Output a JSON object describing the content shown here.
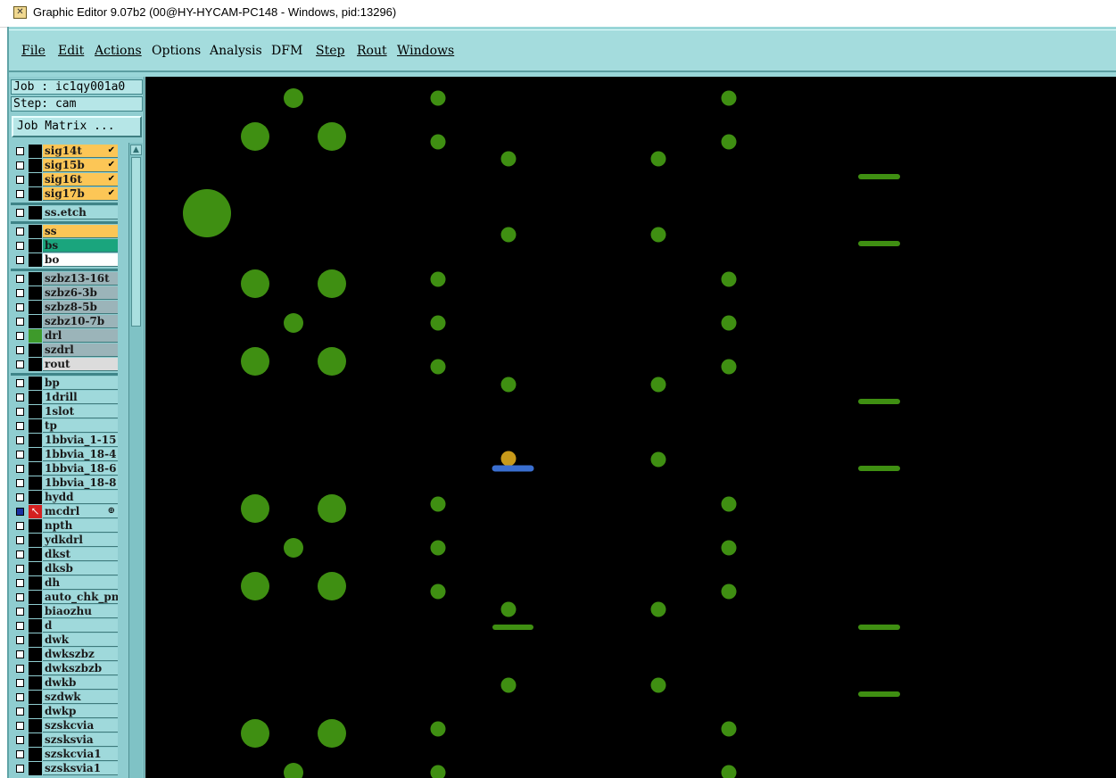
{
  "window": {
    "title": "Graphic Editor 9.07b2 (00@HY-HYCAM-PC148 - Windows, pid:13296)",
    "app_icon": "editor-app-icon"
  },
  "menu": [
    {
      "label": "File"
    },
    {
      "label": "Edit"
    },
    {
      "label": "Actions"
    },
    {
      "label": "Options"
    },
    {
      "label": "Analysis"
    },
    {
      "label": "DFM"
    },
    {
      "label": "Step"
    },
    {
      "label": "Rout"
    },
    {
      "label": "Windows"
    }
  ],
  "job_info": {
    "job": "Job : ic1qy001a0",
    "step": "Step: cam",
    "job_matrix_button": "Job Matrix ..."
  },
  "layers": [
    {
      "name": "sig14t",
      "color": "#fcc656",
      "mark": "✔"
    },
    {
      "name": "sig15b",
      "color": "#fcc656",
      "mark": "✔"
    },
    {
      "name": "sig16t",
      "color": "#fcc656",
      "mark": "✔"
    },
    {
      "name": "sig17b",
      "color": "#fcc656",
      "mark": "✔"
    },
    {
      "name": "ss.etch",
      "color": "#9fd9db",
      "mark": ""
    },
    {
      "name": "ss",
      "color": "#fcc656",
      "mark": ""
    },
    {
      "name": "bs",
      "color": "#1aa57d",
      "mark": ""
    },
    {
      "name": "bo",
      "color": "#ffffff",
      "mark": ""
    },
    {
      "name": "szbz13-16t",
      "color": "#9bb4b9",
      "mark": ""
    },
    {
      "name": "szbz6-3b",
      "color": "#9bb4b9",
      "mark": ""
    },
    {
      "name": "szbz8-5b",
      "color": "#9bb4b9",
      "mark": ""
    },
    {
      "name": "szbz10-7b",
      "color": "#9bb4b9",
      "mark": ""
    },
    {
      "name": "drl",
      "color": "#9bb4b9",
      "mark": "",
      "swatch": "#3e9a2b"
    },
    {
      "name": "szdrl",
      "color": "#9bb4b9",
      "mark": ""
    },
    {
      "name": "rout",
      "color": "#dcdcdc",
      "mark": ""
    },
    {
      "name": "bp",
      "color": "#9fd9db",
      "mark": ""
    },
    {
      "name": "1drill",
      "color": "#9fd9db",
      "mark": ""
    },
    {
      "name": "1slot",
      "color": "#9fd9db",
      "mark": ""
    },
    {
      "name": "tp",
      "color": "#9fd9db",
      "mark": ""
    },
    {
      "name": "1bbvia_1-15",
      "color": "#9fd9db",
      "mark": ""
    },
    {
      "name": "1bbvia_18-4",
      "color": "#9fd9db",
      "mark": ""
    },
    {
      "name": "1bbvia_18-6",
      "color": "#9fd9db",
      "mark": ""
    },
    {
      "name": "1bbvia_18-8",
      "color": "#9fd9db",
      "mark": ""
    },
    {
      "name": "hydd",
      "color": "#9fd9db",
      "mark": ""
    },
    {
      "name": "mcdrl",
      "color": "#9fd9db",
      "mark": "⊕",
      "active": true
    },
    {
      "name": "npth",
      "color": "#9fd9db",
      "mark": ""
    },
    {
      "name": "ydkdrl",
      "color": "#9fd9db",
      "mark": ""
    },
    {
      "name": "dkst",
      "color": "#9fd9db",
      "mark": ""
    },
    {
      "name": "dksb",
      "color": "#9fd9db",
      "mark": ""
    },
    {
      "name": "dh",
      "color": "#9fd9db",
      "mark": ""
    },
    {
      "name": "auto_chk_pn",
      "color": "#9fd9db",
      "mark": ""
    },
    {
      "name": "biaozhu",
      "color": "#9fd9db",
      "mark": ""
    },
    {
      "name": "d",
      "color": "#9fd9db",
      "mark": ""
    },
    {
      "name": "dwk",
      "color": "#9fd9db",
      "mark": ""
    },
    {
      "name": "dwkszbz",
      "color": "#9fd9db",
      "mark": ""
    },
    {
      "name": "dwkszbzb",
      "color": "#9fd9db",
      "mark": ""
    },
    {
      "name": "dwkb",
      "color": "#9fd9db",
      "mark": ""
    },
    {
      "name": "szdwk",
      "color": "#9fd9db",
      "mark": ""
    },
    {
      "name": "dwkp",
      "color": "#9fd9db",
      "mark": ""
    },
    {
      "name": "szskcvia",
      "color": "#9fd9db",
      "mark": ""
    },
    {
      "name": "szsksvia",
      "color": "#9fd9db",
      "mark": ""
    },
    {
      "name": "szskcvia1",
      "color": "#9fd9db",
      "mark": ""
    },
    {
      "name": "szsksvia1",
      "color": "#9fd9db",
      "mark": ""
    }
  ],
  "colors": {
    "pad_green": "#3f8f12",
    "highlight_orange": "#c89a1a",
    "highlight_blue": "#3a6fd0",
    "canvas_bg": "#000000",
    "panel_cyan": "#a4dcdd"
  }
}
